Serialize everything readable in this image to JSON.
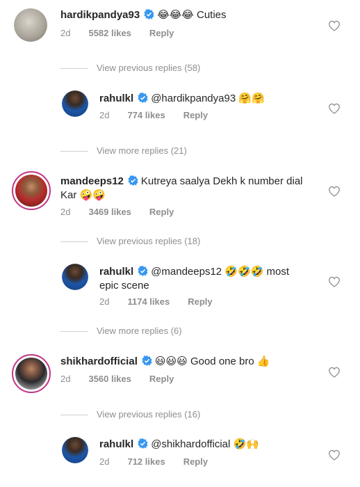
{
  "comments": [
    {
      "username": "hardikpandya93",
      "emoji": "😂😂😂",
      "text": "Cuties",
      "time": "2d",
      "likes": "5582 likes",
      "reply": "Reply",
      "avatar": "avatar-photo"
    },
    {
      "toggle": "View previous replies (58)",
      "username": "rahulkl",
      "mention": "@hardikpandya93",
      "emoji": "🤗🤗",
      "time": "2d",
      "likes": "774 likes",
      "reply": "Reply",
      "avatar": "avatar-photo"
    },
    {
      "toggle": "View more replies (21)",
      "username": "mandeeps12",
      "text": "Kutreya saalya Dekh k number dial",
      "text2": "Kar",
      "emoji": "🤪🤪",
      "time": "2d",
      "likes": "3469 likes",
      "reply": "Reply",
      "avatar": "avatar-photo"
    },
    {
      "toggle": "View previous replies (18)",
      "username": "rahulkl",
      "mention": "@mandeeps12",
      "emoji": "🤣🤣🤣",
      "text": "most",
      "text2": "epic scene",
      "time": "2d",
      "likes": "1174 likes",
      "reply": "Reply",
      "avatar": "avatar-photo"
    },
    {
      "toggle": "View more replies (6)",
      "username": "shikhardofficial",
      "emoji": "😃😃😃",
      "text": "Good one bro",
      "emoji2": "👍",
      "time": "2d",
      "likes": "3560 likes",
      "reply": "Reply",
      "avatar": "avatar-photo"
    },
    {
      "toggle": "View previous replies (16)",
      "username": "rahulkl",
      "mention": "@shikhardofficial",
      "emoji": "🤣🙌",
      "time": "2d",
      "likes": "712 likes",
      "reply": "Reply",
      "avatar": "avatar-photo"
    }
  ],
  "icons": {
    "verified": "verified-badge-icon",
    "like": "heart-outline-icon"
  },
  "colors": {
    "verified": "#3897f0",
    "story_ring": "#c13584",
    "muted": "#8e8e8e"
  }
}
